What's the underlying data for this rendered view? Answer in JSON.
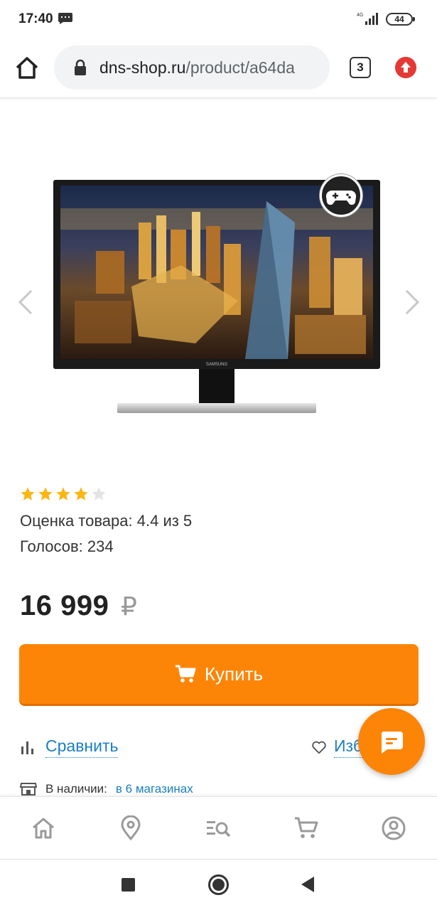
{
  "status_bar": {
    "time": "17:40",
    "battery": "44",
    "network": "4G"
  },
  "browser": {
    "url_host": "dns-shop.ru",
    "url_path": "/product/a64da",
    "tab_count": "3"
  },
  "product": {
    "rating_fraction": 0.88,
    "rating_text": "Оценка товара: 4.4 из 5",
    "votes_text": "Голосов: 234",
    "price": "16 999",
    "currency": "₽",
    "brand_on_image": "SAMSUNG"
  },
  "actions": {
    "buy_label": "Купить",
    "compare_label": "Сравнить",
    "favorite_label": "Изб"
  },
  "availability": {
    "label": "В наличии:",
    "link": "в 6 магазинах"
  },
  "bottom_nav": {
    "items": [
      "home-icon",
      "location-pin-icon",
      "catalog-search-icon",
      "cart-icon",
      "profile-icon"
    ]
  },
  "colors": {
    "accent_orange": "#fc8507",
    "link_blue": "#1a7fc1",
    "star_gold": "#fcb614"
  }
}
